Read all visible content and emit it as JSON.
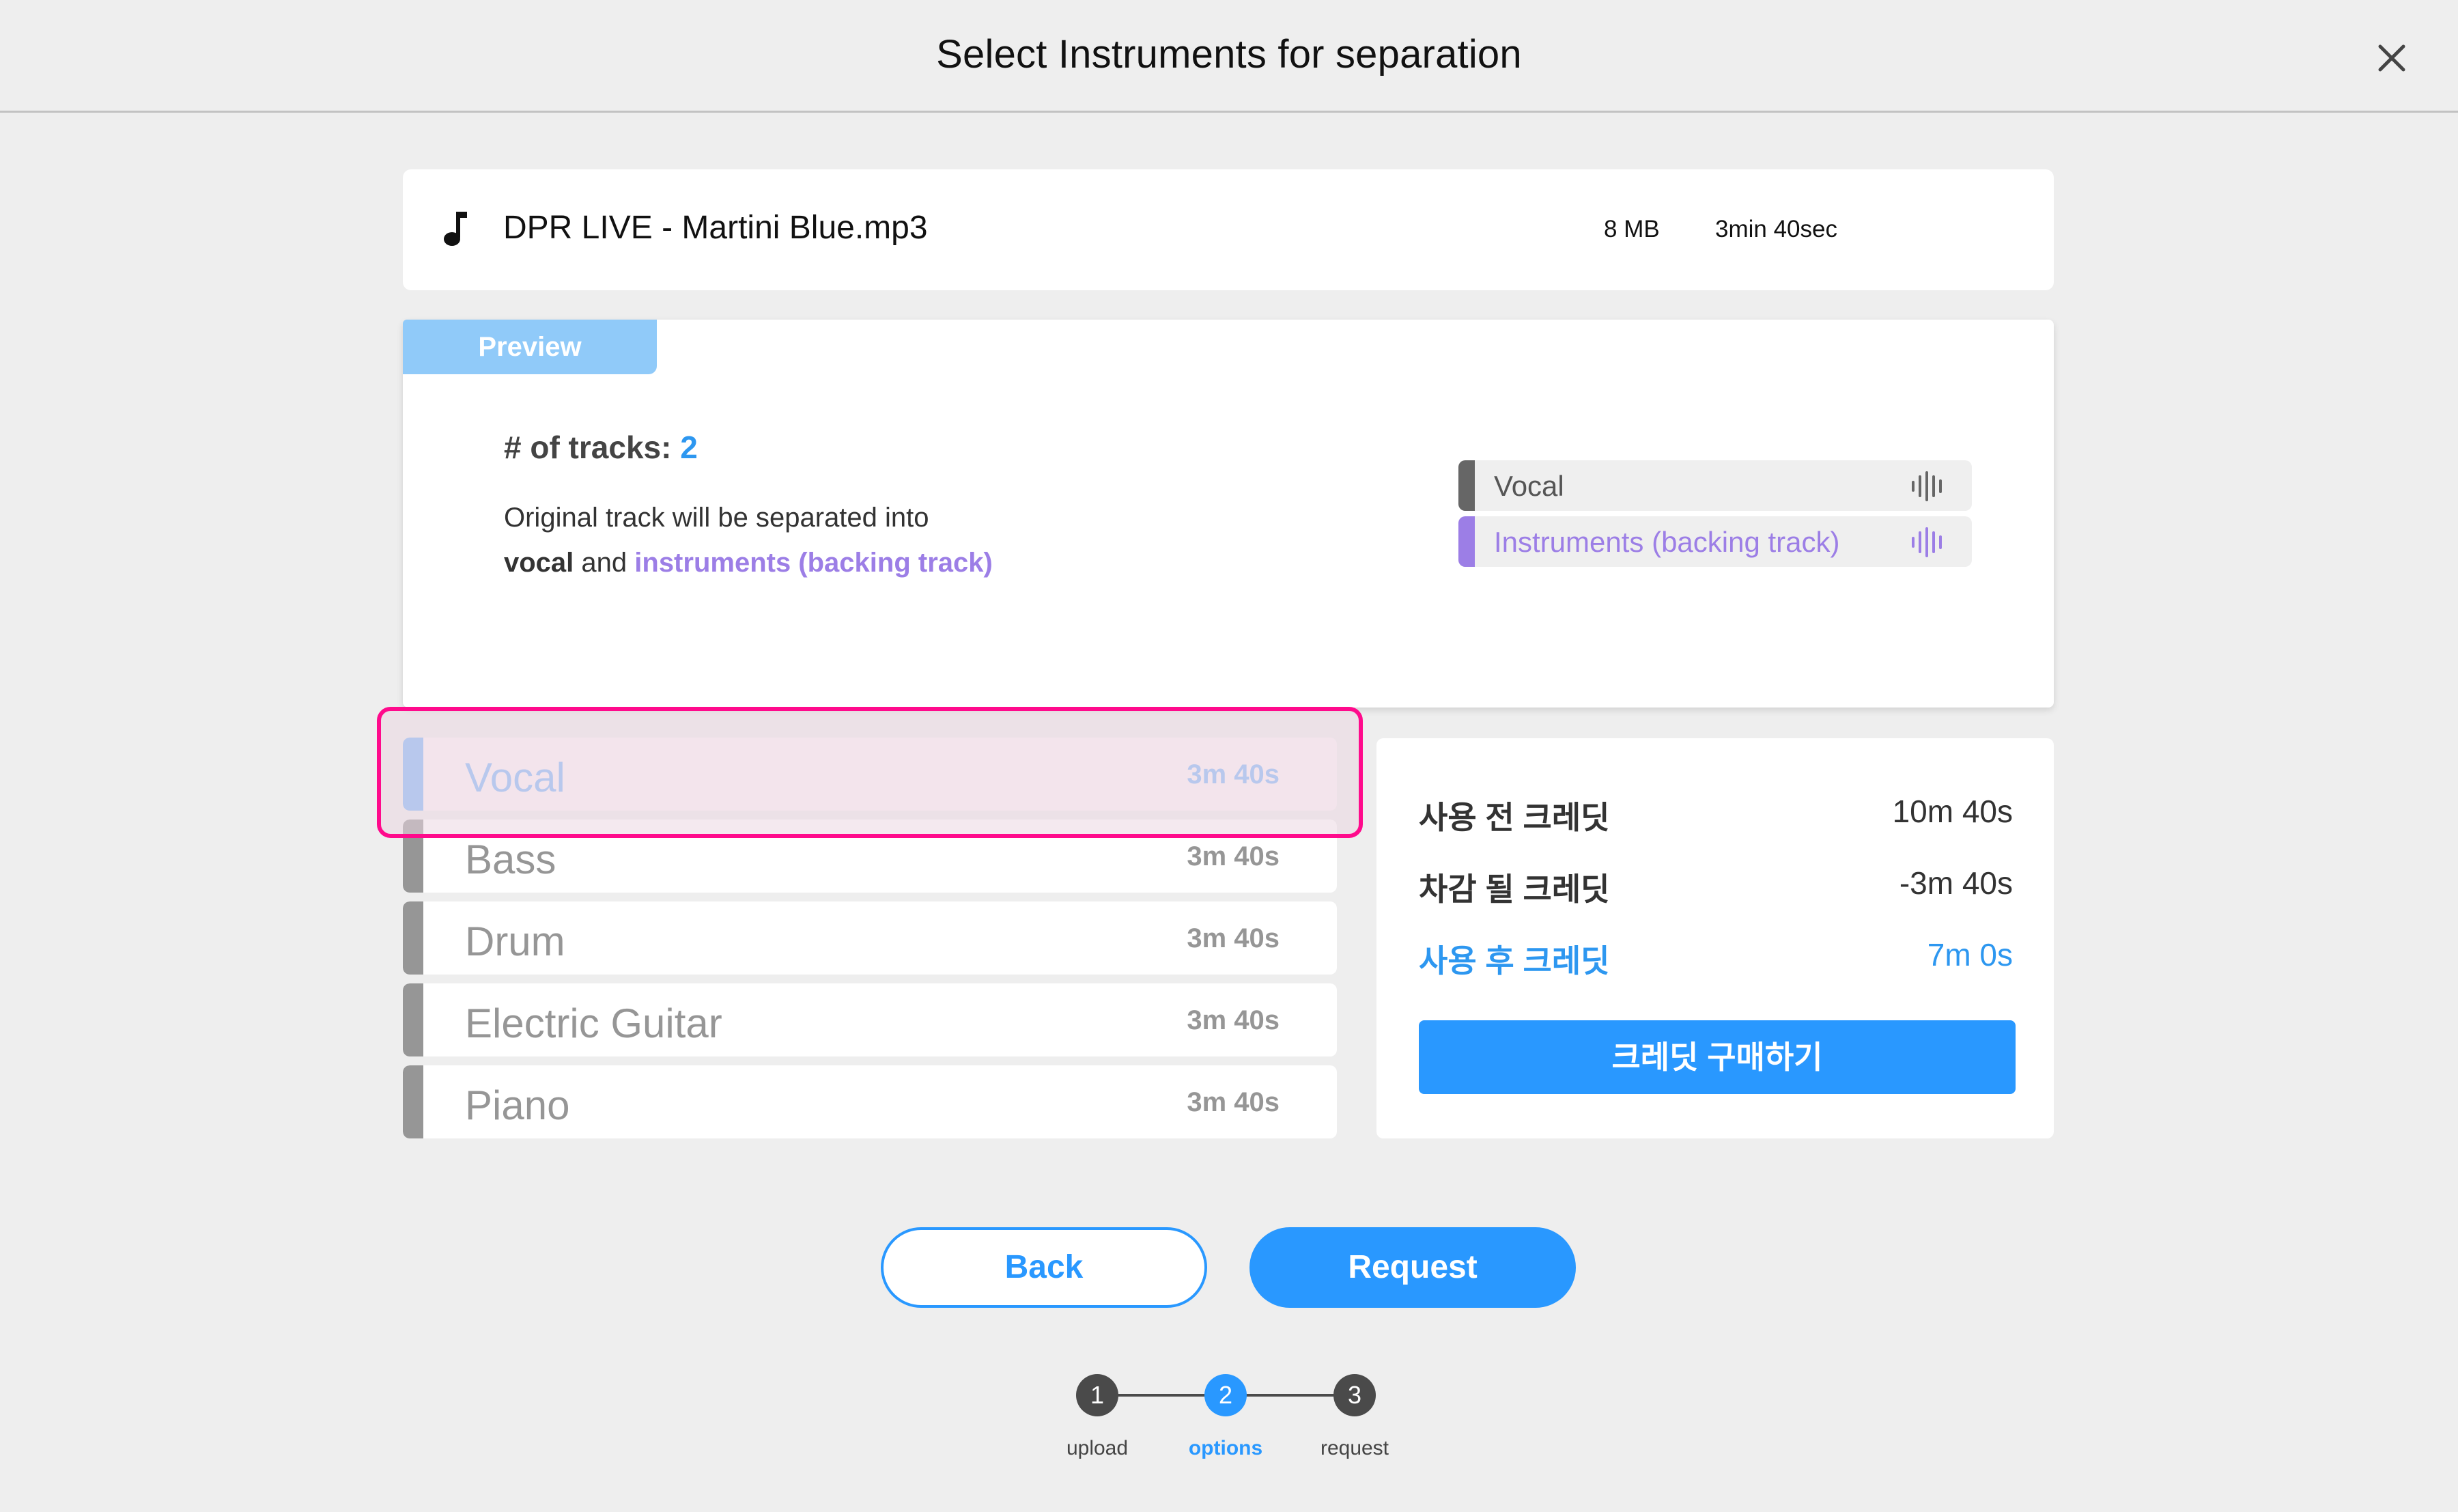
{
  "header": {
    "title": "Select Instruments for separation",
    "close_icon": "close-icon"
  },
  "file": {
    "icon": "music-note-icon",
    "name": "DPR LIVE - Martini Blue.mp3",
    "size": "8 MB",
    "duration": "3min 40sec"
  },
  "preview": {
    "tab_label": "Preview",
    "tracks_label": "# of tracks:",
    "tracks_count": "2",
    "description_line1": "Original track will be separated into",
    "description_bold": "vocal",
    "description_and": " and ",
    "description_highlight": "instruments (backing track)",
    "tracks": [
      {
        "label": "Vocal",
        "color": "#666666",
        "icon": "waveform-icon"
      },
      {
        "label": "Instruments (backing track)",
        "color": "#9c7ee6",
        "icon": "waveform-icon"
      }
    ]
  },
  "instruments": [
    {
      "name": "Vocal",
      "duration": "3m 40s",
      "selected": true
    },
    {
      "name": "Bass",
      "duration": "3m 40s",
      "selected": false
    },
    {
      "name": "Drum",
      "duration": "3m 40s",
      "selected": false
    },
    {
      "name": "Electric Guitar",
      "duration": "3m 40s",
      "selected": false
    },
    {
      "name": "Piano",
      "duration": "3m 40s",
      "selected": false
    }
  ],
  "credits": {
    "before_label": "사용 전 크레딧",
    "before_value": "10m 40s",
    "deduct_label": "차감 될 크레딧",
    "deduct_value": "-3m 40s",
    "after_label": "사용 후 크레딧",
    "after_value": "7m 0s",
    "buy_button": "크레딧 구매하기"
  },
  "actions": {
    "back": "Back",
    "request": "Request"
  },
  "stepper": {
    "current": 2,
    "steps": [
      {
        "number": "1",
        "label": "upload"
      },
      {
        "number": "2",
        "label": "options"
      },
      {
        "number": "3",
        "label": "request"
      }
    ]
  },
  "colors": {
    "accent": "#2998ff",
    "selected_instrument": "#7ab6fa",
    "highlight_border": "#ff0a8c",
    "backing_track": "#9c7ee6"
  }
}
